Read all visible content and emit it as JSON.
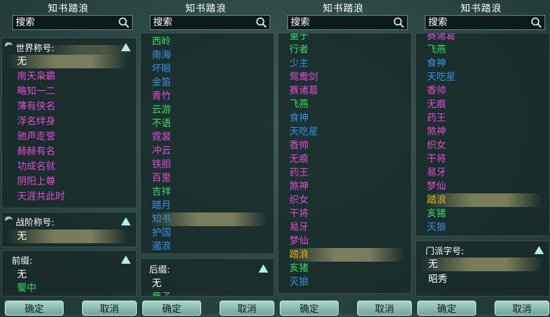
{
  "colors": {
    "white": "#ffffff",
    "magenta": "#e04bd6",
    "green": "#3fd66a",
    "blue": "#3a8fe6",
    "gold": "#e8b21a"
  },
  "icons": {
    "search": "magnifier-icon",
    "collapse": "triangle-up-icon"
  },
  "columns": [
    {
      "title": "知书踏浪",
      "search_placeholder": "搜索",
      "confirm_label": "确定",
      "cancel_label": "取消",
      "sections": [
        {
          "label": "世界称号:",
          "items": [
            {
              "text": "无",
              "color": "#ffffff",
              "selected": true
            },
            {
              "text": "南天枭霸",
              "color": "#e04bd6"
            },
            {
              "text": "略知一二",
              "color": "#e04bd6"
            },
            {
              "text": "薄有侠名",
              "color": "#e04bd6"
            },
            {
              "text": "浮名绊身",
              "color": "#e04bd6"
            },
            {
              "text": "驰声走誉",
              "color": "#e04bd6"
            },
            {
              "text": "赫赫有名",
              "color": "#e04bd6"
            },
            {
              "text": "功成名就",
              "color": "#e04bd6"
            },
            {
              "text": "阴阳上尊",
              "color": "#e04bd6"
            },
            {
              "text": "天涯共此时",
              "color": "#e04bd6"
            }
          ]
        },
        {
          "label": "战阶称号:",
          "items": [
            {
              "text": "无",
              "color": "#ffffff",
              "selected": true
            }
          ]
        },
        {
          "label": "前缀:",
          "items": [
            {
              "text": "无",
              "color": "#ffffff"
            },
            {
              "text": "蜀中",
              "color": "#3fd66a"
            }
          ]
        }
      ]
    },
    {
      "title": "知书踏浪",
      "search_placeholder": "搜索",
      "confirm_label": "确定",
      "cancel_label": "取消",
      "items": [
        {
          "text": "西岭",
          "color": "#3fd66a"
        },
        {
          "text": "南海",
          "color": "#3a8fe6"
        },
        {
          "text": "坏眼",
          "color": "#3a8fe6"
        },
        {
          "text": "金笛",
          "color": "#3a8fe6"
        },
        {
          "text": "青竹",
          "color": "#e04bd6"
        },
        {
          "text": "云游",
          "color": "#3fd66a"
        },
        {
          "text": "不语",
          "color": "#3fd66a"
        },
        {
          "text": "霓裳",
          "color": "#e04bd6"
        },
        {
          "text": "冲云",
          "color": "#e04bd6"
        },
        {
          "text": "铁胆",
          "color": "#e04bd6"
        },
        {
          "text": "百里",
          "color": "#e04bd6"
        },
        {
          "text": "吉祥",
          "color": "#3fd66a"
        },
        {
          "text": "踏月",
          "color": "#3a8fe6"
        },
        {
          "text": "知书",
          "color": "#3a8fe6",
          "selected": true
        },
        {
          "text": "护国",
          "color": "#3a8fe6"
        },
        {
          "text": "遏浪",
          "color": "#3a8fe6"
        }
      ],
      "suffix_section": {
        "label": "后缀:",
        "items": [
          {
            "text": "无",
            "color": "#ffffff"
          },
          {
            "text": "童子",
            "color": "#3fd66a"
          }
        ]
      }
    },
    {
      "title": "知书踏浪",
      "search_placeholder": "搜索",
      "confirm_label": "确定",
      "cancel_label": "取消",
      "items": [
        {
          "text": "重于",
          "color": "#3fd66a"
        },
        {
          "text": "行者",
          "color": "#3fd66a"
        },
        {
          "text": "少主",
          "color": "#3a8fe6"
        },
        {
          "text": "鸳鸯剑",
          "color": "#e04bd6"
        },
        {
          "text": "赛诸葛",
          "color": "#e04bd6"
        },
        {
          "text": "飞燕",
          "color": "#3fd66a"
        },
        {
          "text": "食神",
          "color": "#3a8fe6"
        },
        {
          "text": "天吃星",
          "color": "#3a8fe6"
        },
        {
          "text": "香帅",
          "color": "#e04bd6"
        },
        {
          "text": "无痕",
          "color": "#e04bd6"
        },
        {
          "text": "药王",
          "color": "#e04bd6"
        },
        {
          "text": "煞神",
          "color": "#e04bd6"
        },
        {
          "text": "织女",
          "color": "#e04bd6"
        },
        {
          "text": "干将",
          "color": "#e04bd6"
        },
        {
          "text": "易牙",
          "color": "#e04bd6"
        },
        {
          "text": "梦仙",
          "color": "#e04bd6"
        },
        {
          "text": "踏浪",
          "color": "#e8b21a",
          "selected": true
        },
        {
          "text": "亥猪",
          "color": "#3fd66a"
        },
        {
          "text": "灭狼",
          "color": "#3a8fe6"
        }
      ]
    },
    {
      "title": "知书踏浪",
      "search_placeholder": "搜索",
      "confirm_label": "确定",
      "cancel_label": "取消",
      "items": [
        {
          "text": "赛诸葛",
          "color": "#e04bd6"
        },
        {
          "text": "飞燕",
          "color": "#3fd66a"
        },
        {
          "text": "食神",
          "color": "#3a8fe6"
        },
        {
          "text": "天吃星",
          "color": "#3a8fe6"
        },
        {
          "text": "香帅",
          "color": "#e04bd6"
        },
        {
          "text": "无痕",
          "color": "#e04bd6"
        },
        {
          "text": "药王",
          "color": "#e04bd6"
        },
        {
          "text": "煞神",
          "color": "#e04bd6"
        },
        {
          "text": "织女",
          "color": "#e04bd6"
        },
        {
          "text": "干将",
          "color": "#e04bd6"
        },
        {
          "text": "易牙",
          "color": "#e04bd6"
        },
        {
          "text": "梦仙",
          "color": "#e04bd6"
        },
        {
          "text": "踏浪",
          "color": "#e8b21a",
          "selected": true
        },
        {
          "text": "亥猪",
          "color": "#3fd66a"
        },
        {
          "text": "灭狼",
          "color": "#3a8fe6"
        }
      ],
      "sect_section": {
        "label": "门派字号:",
        "items": [
          {
            "text": "无",
            "color": "#ffffff",
            "selected": true
          },
          {
            "text": "昭秀",
            "color": "#ffffff"
          }
        ]
      }
    }
  ]
}
